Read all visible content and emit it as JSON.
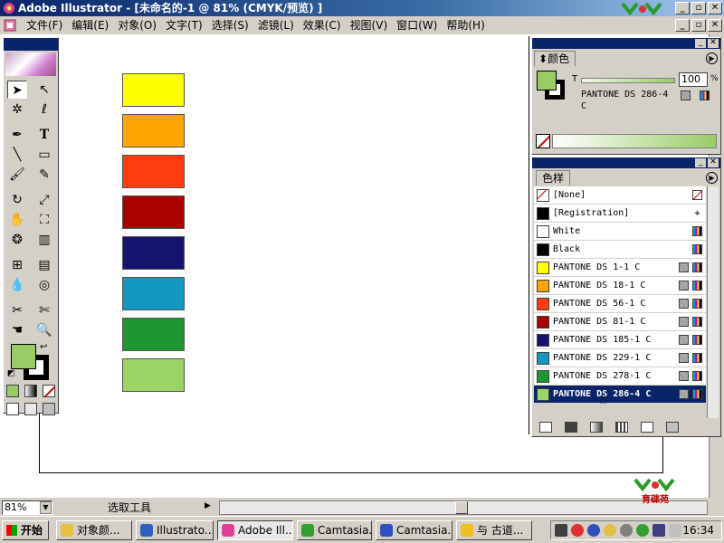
{
  "window": {
    "title": "Adobe Illustrator - [未命名的-1 @ 81% (CMYK/预览) ]",
    "minimize": "_",
    "maximize": "▫",
    "close": "✕"
  },
  "menu": {
    "items": [
      "文件(F)",
      "编辑(E)",
      "对象(O)",
      "文字(T)",
      "选择(S)",
      "滤镜(L)",
      "效果(C)",
      "视图(V)",
      "窗口(W)",
      "帮助(H)"
    ]
  },
  "logo": {
    "text": "育碟苑"
  },
  "artboard_swatches": [
    {
      "name": "PANTONE DS 1-1 C",
      "color": "#ffff00"
    },
    {
      "name": "PANTONE DS 18-1 C",
      "color": "#ffa500"
    },
    {
      "name": "PANTONE DS 56-1 C",
      "color": "#ff3c0f"
    },
    {
      "name": "PANTONE DS 81-1 C",
      "color": "#aa0000"
    },
    {
      "name": "PANTONE DS 185-1 C",
      "color": "#14146e"
    },
    {
      "name": "PANTONE DS 229-1 C",
      "color": "#1497c1"
    },
    {
      "name": "PANTONE DS 278-1 C",
      "color": "#1e9632"
    },
    {
      "name": "PANTONE DS 286-4 C",
      "color": "#99d464"
    }
  ],
  "toolbox": {
    "fill_color": "#99cc66",
    "stroke_color": "#000000"
  },
  "color_panel": {
    "tab": "颜色",
    "tint_label": "T",
    "tint_value": "100",
    "tint_unit": "%",
    "swatch_name": "PANTONE DS 286-4 C",
    "fill_color": "#99cc66"
  },
  "swatch_panel": {
    "tab": "色样",
    "items": [
      {
        "name": "[None]",
        "color": "none",
        "indicator": "none",
        "selected": false
      },
      {
        "name": "[Registration]",
        "color": "#000000",
        "indicator": "registration",
        "selected": false
      },
      {
        "name": "White",
        "color": "#ffffff",
        "indicator": "cmyk",
        "selected": false
      },
      {
        "name": "Black",
        "color": "#000000",
        "indicator": "cmyk",
        "selected": false
      },
      {
        "name": "PANTONE DS 1-1 C",
        "color": "#ffff00",
        "indicator": "spot",
        "selected": false
      },
      {
        "name": "PANTONE DS 18-1 C",
        "color": "#ffa500",
        "indicator": "spot",
        "selected": false
      },
      {
        "name": "PANTONE DS 56-1 C",
        "color": "#ff3c0f",
        "indicator": "spot",
        "selected": false
      },
      {
        "name": "PANTONE DS 81-1 C",
        "color": "#aa0000",
        "indicator": "spot",
        "selected": false
      },
      {
        "name": "PANTONE DS 185-1 C",
        "color": "#14146e",
        "indicator": "spot",
        "selected": false
      },
      {
        "name": "PANTONE DS 229-1 C",
        "color": "#1497c1",
        "indicator": "spot",
        "selected": false
      },
      {
        "name": "PANTONE DS 278-1 C",
        "color": "#1e9632",
        "indicator": "spot",
        "selected": false
      },
      {
        "name": "PANTONE DS 286-4 C",
        "color": "#99d464",
        "indicator": "spot",
        "selected": true
      }
    ]
  },
  "statusbar": {
    "zoom": "81%",
    "tool": "选取工具"
  },
  "taskbar": {
    "start": "开始",
    "tasks": [
      {
        "label": "对象颜...",
        "icon_color": "#e8c040",
        "active": false
      },
      {
        "label": "Illustrato...",
        "icon_color": "#3060c0",
        "active": false
      },
      {
        "label": "Adobe Ill...",
        "icon_color": "#e0409a",
        "active": true
      },
      {
        "label": "Camtasia...",
        "icon_color": "#30a030",
        "active": false
      },
      {
        "label": "Camtasia...",
        "icon_color": "#3050c0",
        "active": false
      },
      {
        "label": "与 古道...",
        "icon_color": "#f0c020",
        "active": false
      }
    ],
    "clock": "16:34"
  }
}
